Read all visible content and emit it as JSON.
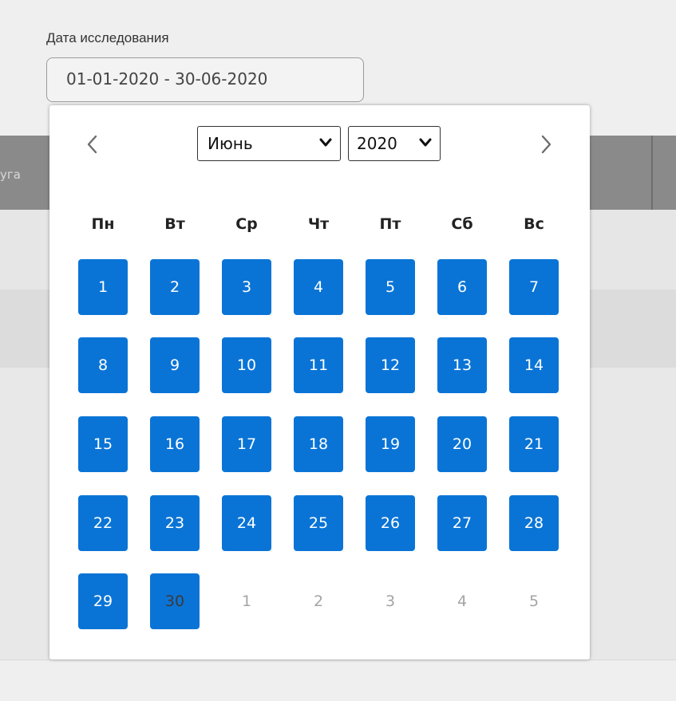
{
  "form": {
    "date_label": "Дата исследования",
    "date_value": "01-01-2020 - 30-06-2020"
  },
  "background": {
    "column_fragment": "уга"
  },
  "datepicker": {
    "prev_icon": "chevron-left-icon",
    "next_icon": "chevron-right-icon",
    "selected_month": "Июнь",
    "selected_year": "2020",
    "weekdays": [
      "Пн",
      "Вт",
      "Ср",
      "Чт",
      "Пт",
      "Сб",
      "Вс"
    ],
    "weeks": [
      [
        {
          "d": "1",
          "s": "in-range"
        },
        {
          "d": "2",
          "s": "in-range"
        },
        {
          "d": "3",
          "s": "in-range"
        },
        {
          "d": "4",
          "s": "in-range"
        },
        {
          "d": "5",
          "s": "in-range"
        },
        {
          "d": "6",
          "s": "in-range"
        },
        {
          "d": "7",
          "s": "in-range"
        }
      ],
      [
        {
          "d": "8",
          "s": "in-range"
        },
        {
          "d": "9",
          "s": "in-range"
        },
        {
          "d": "10",
          "s": "in-range"
        },
        {
          "d": "11",
          "s": "in-range"
        },
        {
          "d": "12",
          "s": "in-range"
        },
        {
          "d": "13",
          "s": "in-range"
        },
        {
          "d": "14",
          "s": "in-range"
        }
      ],
      [
        {
          "d": "15",
          "s": "in-range"
        },
        {
          "d": "16",
          "s": "in-range"
        },
        {
          "d": "17",
          "s": "in-range"
        },
        {
          "d": "18",
          "s": "in-range"
        },
        {
          "d": "19",
          "s": "in-range"
        },
        {
          "d": "20",
          "s": "in-range"
        },
        {
          "d": "21",
          "s": "in-range"
        }
      ],
      [
        {
          "d": "22",
          "s": "in-range"
        },
        {
          "d": "23",
          "s": "in-range"
        },
        {
          "d": "24",
          "s": "in-range"
        },
        {
          "d": "25",
          "s": "in-range"
        },
        {
          "d": "26",
          "s": "in-range"
        },
        {
          "d": "27",
          "s": "in-range"
        },
        {
          "d": "28",
          "s": "in-range"
        }
      ],
      [
        {
          "d": "29",
          "s": "in-range"
        },
        {
          "d": "30",
          "s": "range-end"
        },
        {
          "d": "1",
          "s": "other-month"
        },
        {
          "d": "2",
          "s": "other-month"
        },
        {
          "d": "3",
          "s": "other-month"
        },
        {
          "d": "4",
          "s": "other-month"
        },
        {
          "d": "5",
          "s": "other-month"
        }
      ]
    ]
  },
  "colors": {
    "accent": "#0a74d6",
    "range_end_text": "#3a3a3a",
    "other_month_text": "#a4a4a4",
    "overlay_header": "#8a8a8a"
  }
}
